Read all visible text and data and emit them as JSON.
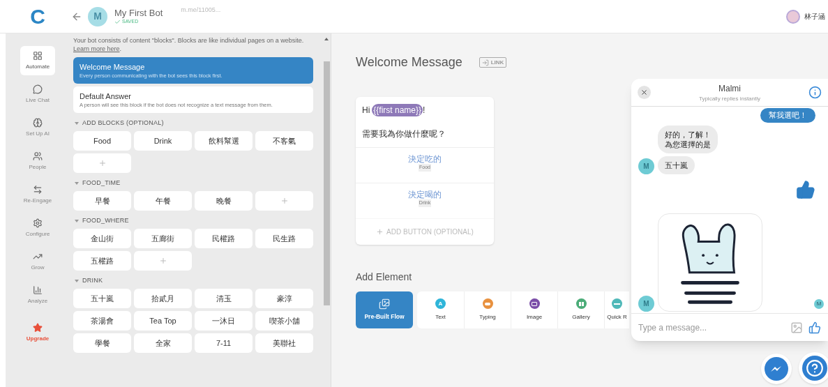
{
  "topbar": {
    "logo": "C",
    "bot_avatar": "M",
    "bot_name": "My First Bot",
    "status": "SAVED",
    "link": "m.me/11005...",
    "user_name": "林子涵"
  },
  "nav": [
    {
      "label": "Automate",
      "selected": true,
      "kind": "normal"
    },
    {
      "label": "Live Chat",
      "selected": false,
      "kind": "normal"
    },
    {
      "label": "Set Up AI",
      "selected": false,
      "kind": "normal"
    },
    {
      "label": "People",
      "selected": false,
      "kind": "normal"
    },
    {
      "label": "Re-Engage",
      "selected": false,
      "kind": "normal"
    },
    {
      "label": "Configure",
      "selected": false,
      "kind": "normal"
    },
    {
      "label": "Grow",
      "selected": false,
      "kind": "normal"
    },
    {
      "label": "Analyze",
      "selected": false,
      "kind": "normal"
    },
    {
      "label": "Upgrade",
      "selected": false,
      "kind": "upgrade"
    }
  ],
  "blocks_panel": {
    "intro": "Your bot consists of content \"blocks\". Blocks are like individual pages on a website.",
    "learn_more": "Learn more here",
    "intro_end": ".",
    "main_blocks": [
      {
        "title": "Welcome Message",
        "description": "Every person communicating with the bot sees this block first.",
        "selected": true
      },
      {
        "title": "Default Answer",
        "description": "A person will see this block if the bot does not recognize a text message from them.",
        "selected": false
      }
    ],
    "sections": [
      {
        "title": "ADD BLOCKS (OPTIONAL)",
        "expanded": true,
        "has_add": true,
        "blocks": [
          "Food",
          "Drink",
          "飲料幫選",
          "不客氣"
        ]
      },
      {
        "title": "FOOD_TIME",
        "expanded": true,
        "has_add": true,
        "blocks": [
          "早餐",
          "午餐",
          "晚餐"
        ]
      },
      {
        "title": "FOOD_WHERE",
        "expanded": true,
        "has_add": true,
        "blocks": [
          "金山街",
          "五廊街",
          "民權路",
          "民生路",
          "五權路"
        ]
      },
      {
        "title": "DRINK",
        "expanded": true,
        "has_add": false,
        "blocks": [
          "五十嵐",
          "拾貳月",
          "清玉",
          "豪淳",
          "茶湯會",
          "Tea Top",
          "一沐日",
          "喫茶小舖",
          "學餐",
          "全家",
          "7-11",
          "美聯社"
        ]
      }
    ]
  },
  "editor": {
    "title": "Welcome Message",
    "link_badge": "LINK",
    "card": {
      "greeting": "Hi",
      "variable": "{{first name}}",
      "greeting_end": "!",
      "text": "需要我為你做什麼呢？",
      "buttons": [
        {
          "label": "決定吃的",
          "target": "Food"
        },
        {
          "label": "決定喝的",
          "target": "Drink"
        }
      ],
      "add_button": "ADD BUTTON (OPTIONAL)"
    },
    "add_element_title": "Add Element",
    "elements": [
      {
        "label": "Pre-Built Flow",
        "kind": "flow",
        "selected": true
      },
      {
        "label": "Text",
        "kind": "text",
        "glyph": "A",
        "color": "#2fb5d9",
        "selected": false
      },
      {
        "label": "Typing",
        "kind": "typing",
        "color": "#e8913f",
        "selected": false
      },
      {
        "label": "Image",
        "kind": "image",
        "color": "#7b4ea8",
        "selected": false
      },
      {
        "label": "Gallery",
        "kind": "gallery",
        "color": "#4bac78",
        "selected": false
      },
      {
        "label": "Quick R",
        "kind": "quick",
        "color": "#4fb8b8",
        "selected": false
      }
    ]
  },
  "chat": {
    "name": "Malmi",
    "subtitle": "Typically replies instantly",
    "messages": [
      {
        "kind": "user_text",
        "lines": [
          "幫我選吧！"
        ]
      },
      {
        "kind": "bot_text",
        "lines": [
          "好的，了解！",
          "為您選擇的是"
        ]
      },
      {
        "kind": "bot_text",
        "lines": [
          "五十嵐"
        ],
        "avatar": "M"
      },
      {
        "kind": "user_like"
      },
      {
        "kind": "bot_sticker",
        "avatar": "M"
      }
    ],
    "read_receipt": "M",
    "placeholder": "Type a message..."
  }
}
